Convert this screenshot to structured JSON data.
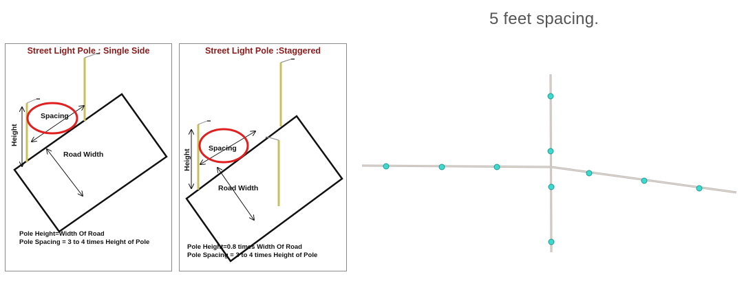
{
  "caption": "5 feet spacing.",
  "panels": {
    "single": {
      "title": "Street Light Pole : Single Side",
      "label_spacing": "Spacing",
      "label_height": "Height",
      "label_road_width": "Road Width",
      "formula_line1": "Pole Height=Width Of Road",
      "formula_line2": "Pole Spacing = 3 to 4 times Height of Pole"
    },
    "staggered": {
      "title": "Street Light Pole :Staggered",
      "label_spacing": "Spacing",
      "label_height": "Height",
      "label_road_width": "Road Width",
      "formula_line1": "Pole Height=0.8 times Width Of Road",
      "formula_line2": "Pole Spacing = 3 to 4 times Height of Pole"
    }
  },
  "colors": {
    "title_text": "#8b1a1a",
    "highlight_ellipse": "#e02020",
    "pole": "#c8c060",
    "road_outline": "#111111",
    "network_line": "#bdb6b0",
    "network_point_fill": "#3fd8cf",
    "network_point_stroke": "#1c9a92"
  }
}
